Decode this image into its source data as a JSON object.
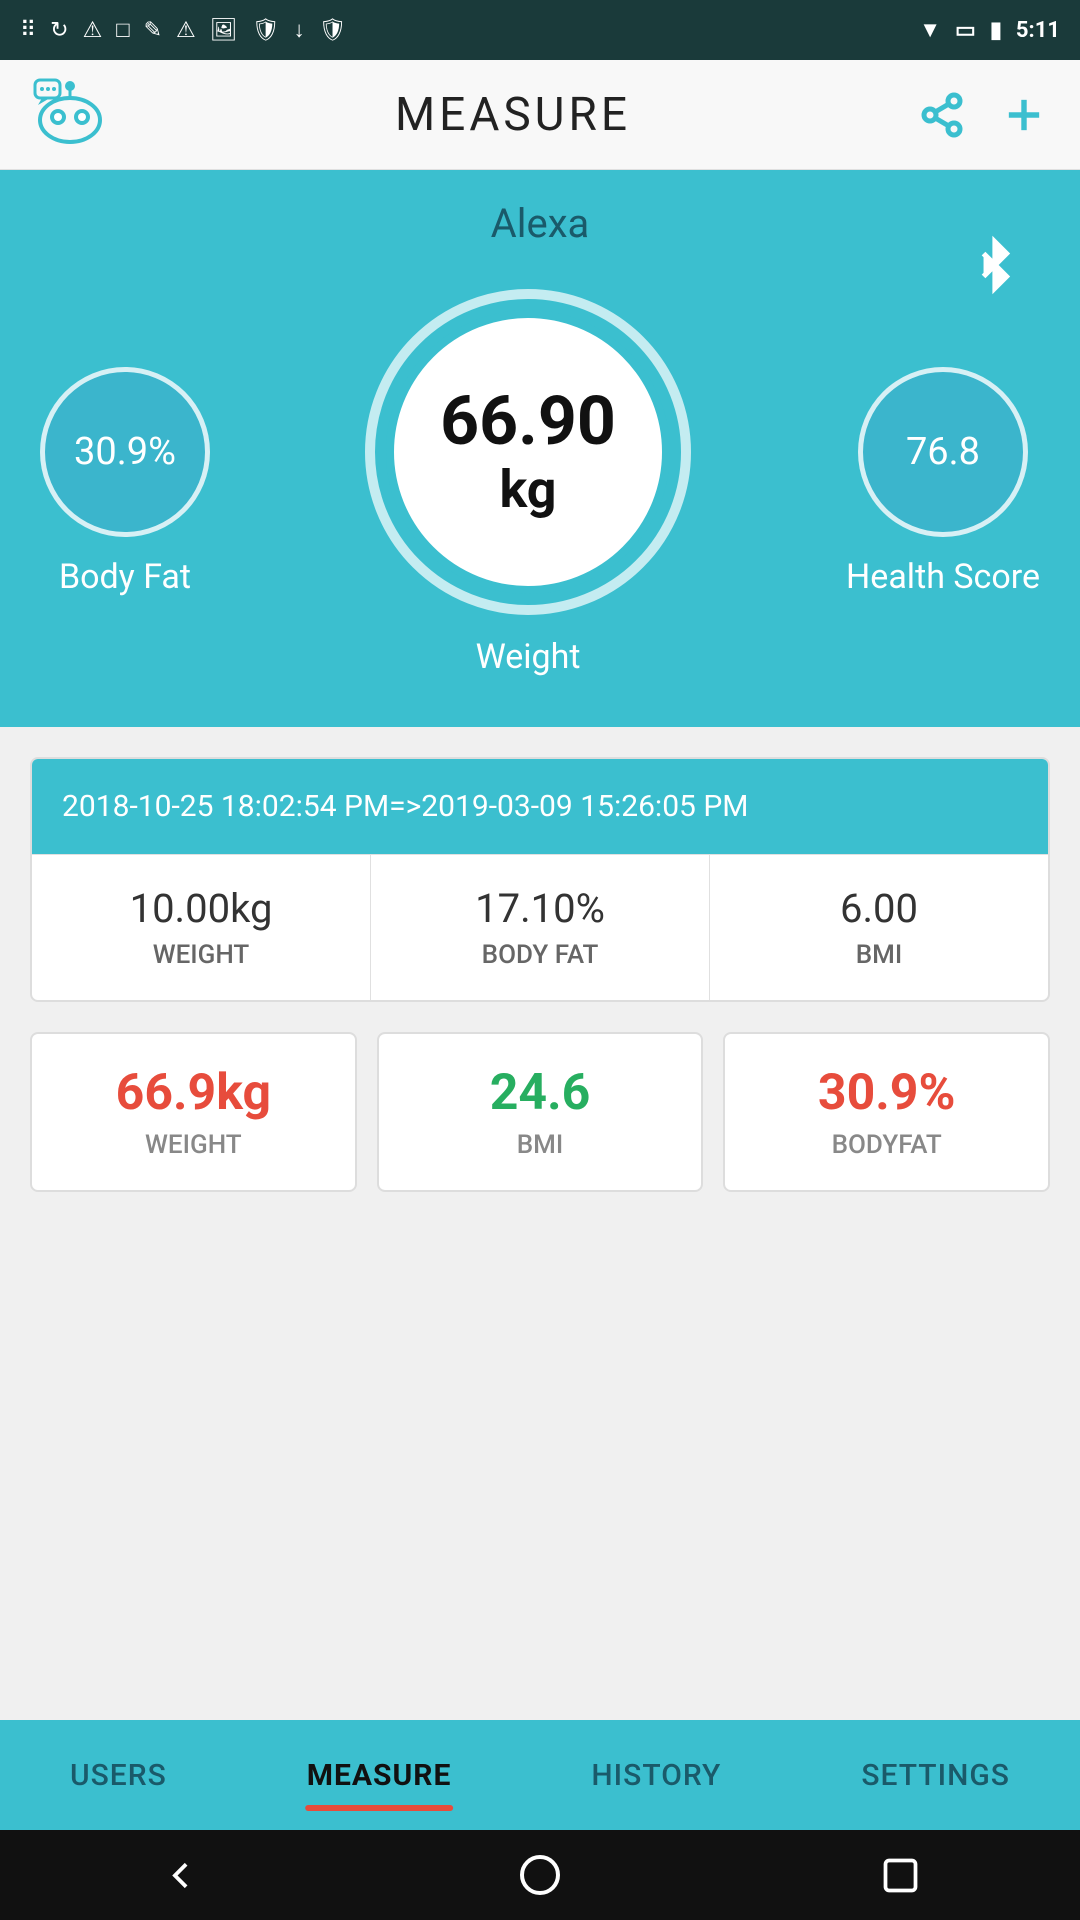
{
  "statusBar": {
    "time": "5:11",
    "icons": [
      "notification",
      "sync",
      "warning",
      "square",
      "pen",
      "warning2",
      "image",
      "shield",
      "download",
      "shield2",
      "wifi",
      "wifi-fill",
      "sim",
      "battery"
    ]
  },
  "appBar": {
    "title": "MEASURE",
    "shareIcon": "share-icon",
    "addIcon": "add-icon"
  },
  "hero": {
    "userName": "Alexa",
    "bluetoothIcon": "bluetooth-icon",
    "bodyFat": {
      "value": "30.9%",
      "label": "Body Fat"
    },
    "weight": {
      "value": "66.90",
      "unit": "kg",
      "label": "Weight"
    },
    "healthScore": {
      "value": "76.8",
      "label": "Health Score"
    }
  },
  "dataCard": {
    "dateRange": "2018-10-25 18:02:54 PM=>2019-03-09 15:26:05 PM",
    "cells": [
      {
        "value": "10.00kg",
        "label": "WEIGHT"
      },
      {
        "value": "17.10%",
        "label": "BODY FAT"
      },
      {
        "value": "6.00",
        "label": "BMI"
      }
    ]
  },
  "statsRow": [
    {
      "value": "66.9kg",
      "label": "WEIGHT",
      "colorClass": "stat-value-red"
    },
    {
      "value": "24.6",
      "label": "BMI",
      "colorClass": "stat-value-green"
    },
    {
      "value": "30.9%",
      "label": "BODYFAT",
      "colorClass": "stat-value-red"
    }
  ],
  "bottomNav": [
    {
      "label": "USERS",
      "active": false
    },
    {
      "label": "MEASURE",
      "active": true
    },
    {
      "label": "HISTORY",
      "active": false
    },
    {
      "label": "SETTINGS",
      "active": false
    }
  ]
}
